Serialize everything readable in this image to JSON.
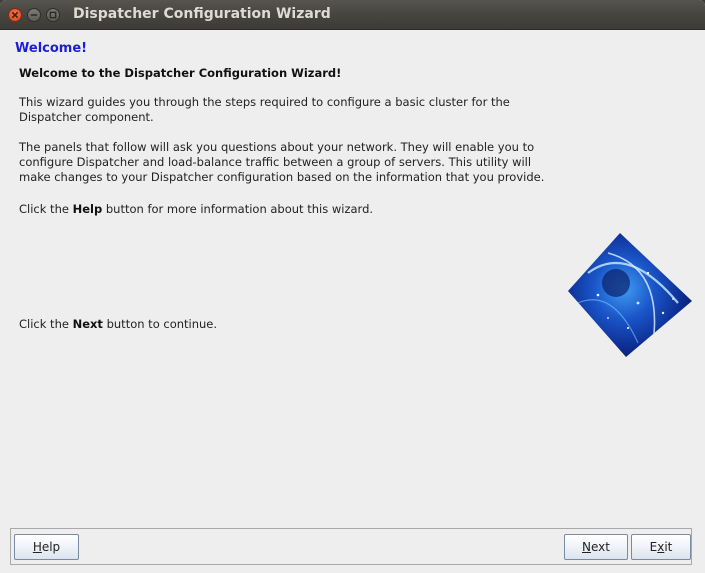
{
  "window": {
    "title": "Dispatcher Configuration Wizard",
    "controls": [
      "close-icon",
      "minimize-icon",
      "maximize-icon"
    ]
  },
  "page": {
    "heading": "Welcome!",
    "subheading": "Welcome to the Dispatcher Configuration Wizard!",
    "paragraph1": "This wizard guides you through the steps required to configure a basic cluster for the Dispatcher component.",
    "paragraph2": "The panels that follow will ask you questions about your network. They will enable you to configure Dispatcher and load-balance traffic between a group of servers. This utility will make changes to your Dispatcher configuration based on the information that you provide.",
    "help_hint": {
      "before": "Click the ",
      "bold": "Help",
      "after": " button for more information about this wizard."
    },
    "next_hint": {
      "before": "Click the ",
      "bold": "Next",
      "after": " button to continue."
    }
  },
  "buttons": {
    "help": {
      "mnemonic": "H",
      "rest": "elp"
    },
    "next": {
      "mnemonic": "N",
      "rest": "ext"
    },
    "exit": {
      "first": "E",
      "mnemonic": "x",
      "rest": "it"
    }
  },
  "colors": {
    "heading": "#1d1dd8",
    "titlebar": "#46443f",
    "close_button": "#e0522a",
    "background": "#eeeeee"
  },
  "graphic": {
    "name": "galaxy-image"
  }
}
